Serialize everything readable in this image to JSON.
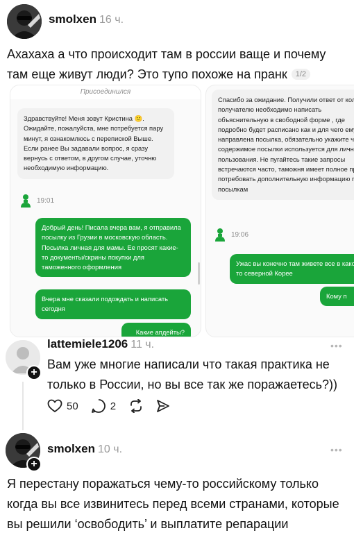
{
  "post1": {
    "username": "smolxen",
    "time": "16 ч.",
    "text": "Ахахаха а что происходит там в россии ваще и почему там еще живут люди? Это тупо похоже на пранк",
    "page_indicator": "1/2",
    "avatar_icon": "user-avatar-icon"
  },
  "screenshot1": {
    "header": "Присоединился",
    "msg_in": "Здравствуйте! Меня зовут Кристина . Ожидайте, пожалуйста, мне потребуется пару минут, я ознакомлюсь с перепиской Выше. Если ранее Вы задавали вопрос, я сразу вернусь с ответом, в другом случае, уточню необходимую информацию.",
    "emoji": "🙂",
    "agent_time": "19:01",
    "msg_out_1": "Добрый день! Писала вчера вам, я отправила посылку из Грузии в московскую область. Посылка личная для мамы. Ее просят какие-то документы/скрины покупки для таможенного оформления",
    "msg_out_2": "Вчера мне сказали подождать и написать сегодня",
    "msg_out_3": "Какие апдейты?"
  },
  "screenshot2": {
    "msg_in": "Спасибо за ожидание. Получили ответ от коллег, получателю необходимо написать объяснительную в свободной форме , где подробно будет расписано как и для чего ему направлена посылка, обязательно укажите что содержимое посылки используется для личного пользования. Не пугайтесь такие запросы встречаются часто, таможня имеет полное право потребовать дополнительную информацию по посылкам",
    "agent_time": "19:06",
    "msg_out_1": "Ужас вы конечно там живете все в какой-то северной Корее",
    "msg_out_2": "Кому п"
  },
  "comment1": {
    "username": "lattemiele1206",
    "time": "11 ч.",
    "more": "•••",
    "text": "Вам уже многие написали что такая практика не только в России, но вы все так же поражаетесь?))",
    "likes": "50",
    "replies": "2"
  },
  "comment2": {
    "username": "smolxen",
    "time": "10 ч.",
    "more": "•••",
    "text": "Я перестану поражаться чему-то российскому только когда вы все извинитесь перед всеми странами, которые вы решили ‘освободить’ и выплатите репарации"
  },
  "colors": {
    "accent_green": "#1aa53a",
    "text": "#111111",
    "muted": "#9a9a9a"
  }
}
